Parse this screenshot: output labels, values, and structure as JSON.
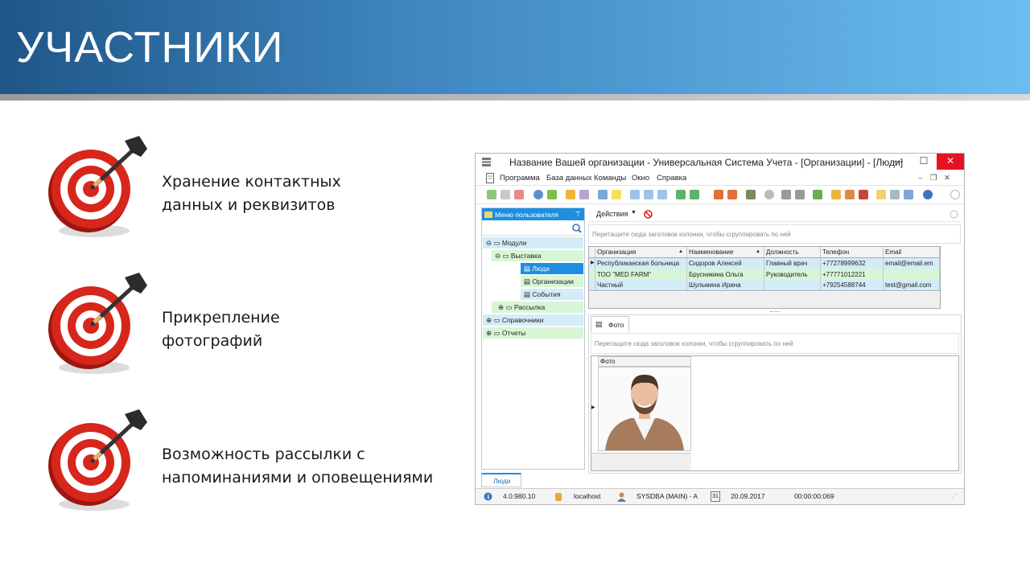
{
  "slide": {
    "title": "УЧАСТНИКИ",
    "features": [
      {
        "line1": "Хранение контактных",
        "line2": "данных и реквизитов"
      },
      {
        "line1": "Прикрепление",
        "line2": "фотографий"
      },
      {
        "line1": "Возможность рассылки с",
        "line2": "напоминаниями и оповещениями"
      }
    ]
  },
  "app": {
    "title": "Название Вашей организации - Универсальная Система Учета - [Организации] - [Люди]",
    "window_controls": {
      "minimize": "—",
      "maximize": "☐",
      "close": "✕"
    },
    "mdi_controls": {
      "minimize": "–",
      "restore": "❐",
      "close": "✕"
    },
    "menu": [
      "Программа",
      "База данных",
      "Команды",
      "Окно",
      "Справка"
    ],
    "left_panel": {
      "header": "Меню пользователя",
      "pin": "⊤",
      "tree": [
        "Модули",
        "Выставка",
        "Люди",
        "Организации",
        "События",
        "Рассылка",
        "Справочники",
        "Отчеты"
      ]
    },
    "actions_label": "Действия",
    "group_hint": "Перетащите сюда заголовок колонки, чтобы сгруппировать по ней",
    "grid": {
      "columns": [
        "Организация",
        "Наименование",
        "Должность",
        "Телефон",
        "Email"
      ],
      "rows": [
        [
          "Республиканская больница",
          "Сидоров Алексей",
          "Главный врач",
          "+77278999632",
          "email@email.em"
        ],
        [
          "ТОО \"MED FARM\"",
          "Брусникина Ольга",
          "Руководитель",
          "+77771012221",
          ""
        ],
        [
          "Частный",
          "Шульмина Ирина",
          "",
          "+79254588744",
          "test@gmail.com"
        ]
      ]
    },
    "photo_tab": "Фото",
    "photo_group_hint": "Перетащите сюда заголовок колонки, чтобы сгруппировать по ней",
    "photo_column": "Фото",
    "bottom_tab": "Люди",
    "status": {
      "version": "4.0.980.10",
      "server": "localhost",
      "user": "SYSDBA (MAIN) - A",
      "calendar_day": "31",
      "date": "20.09.2017",
      "timer": "00:00:00:069"
    }
  },
  "colors": {
    "banner_dark": "#1f5688",
    "banner_light": "#6bbdf2",
    "target_red": "#d7261b",
    "selection_blue": "#1e8fe0",
    "row_green": "#d8f5d5",
    "row_blue": "#d4ecf8"
  }
}
